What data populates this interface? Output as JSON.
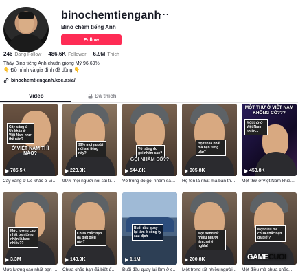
{
  "profile": {
    "username": "binochemtienganh",
    "display_name": "Bino chém tiếng Anh",
    "follow_label": "Follow",
    "more_icon": "more-dots-icon",
    "stats": [
      {
        "value": "246",
        "label": "Đang Follow"
      },
      {
        "value": "486.6K",
        "label": "Follower"
      },
      {
        "value": "6.9M",
        "label": "Thích"
      }
    ],
    "bio_lines": [
      "Thầy Bino tiếng Anh chuẩn giọng Mỹ 96.69%",
      "👇 Đồ mình và gia đình đã dùng 👇"
    ],
    "link": "binochemtienganh.koc.asia/"
  },
  "tabs": [
    {
      "label": "Video",
      "active": true
    },
    {
      "label": "Đã thích",
      "active": false
    }
  ],
  "videos": [
    {
      "views": "785.5K",
      "caption": "Cày xăng ở Úc khác ở Việt Nam...",
      "overlay": "Cây xăng ở Úc khác ở Việt Nam như thế nào?",
      "title": "Ở VIỆT NAM THÌ NÀO?"
    },
    {
      "views": "223.9K",
      "caption": "99% mọi người nói sai tiếng...",
      "overlay": "99% mọi người nói sai tiếng này?",
      "title": ""
    },
    {
      "views": "544.8K",
      "caption": "Vô trông do gọi nhầm sao?...",
      "overlay": "Vô trông do gọi nhầm sao?",
      "title": "GỌI NHẦM SỐ??"
    },
    {
      "views": "905.8K",
      "caption": "Họ tên là nhất mà bạn thăng...",
      "overlay": "Họ tên là nhất mà bạn từng gặp?",
      "title": ""
    },
    {
      "views": "453.8K",
      "caption": "Một thứ ở Việt Nam khiến tôi...",
      "overlay": "Một thứ ở Việt Nam khiến...",
      "title": "MỘT THỨ Ở VIỆT NAM KHÔNG CÓ???"
    },
    {
      "views": "3.3M",
      "caption": "Mức lương cao nhất bạn nhận...",
      "overlay": "Mức lương cao nhất bạn từng nhận là bao nhiêu??",
      "title": ""
    },
    {
      "views": "143.9K",
      "caption": "Chưa chắc bạn đã biết đâu...",
      "overlay": "Chưa chắc bạn đã biết điều này?",
      "title": ""
    },
    {
      "views": "1.1M",
      "caption": "Buổi đầu quay lại làm ở công...",
      "overlay": "Buổi đầu quay lại làm ở công ty sau dịch",
      "title": ""
    },
    {
      "views": "200.8K",
      "caption": "Một trend rất nhiều người...",
      "overlay": "Một trend rất nhiều người làm, sai ý nghĩa!",
      "title": ""
    },
    {
      "views": "",
      "caption": "Một điều mà chưa chắc...",
      "overlay": "Một điều mà chưa chắc bạn đã biết?",
      "title": ""
    }
  ],
  "watermark": {
    "part1": "GAME",
    "part2": "CUOI"
  },
  "colors": {
    "accent": "#fe2c55",
    "text": "#161823",
    "muted": "#757575"
  }
}
